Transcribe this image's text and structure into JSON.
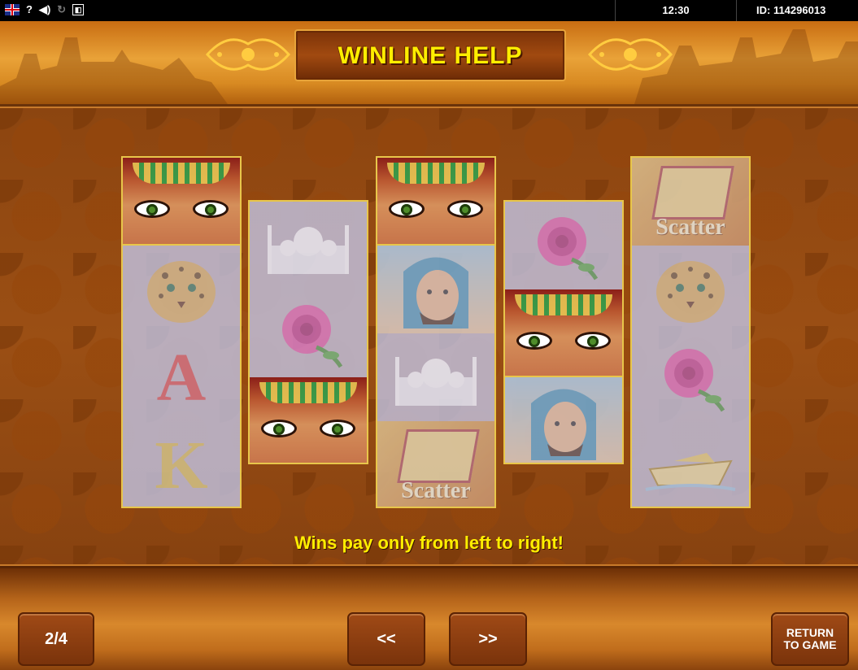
{
  "status_bar": {
    "help_icon": "?",
    "time": "12:30",
    "id": "ID: 114296013"
  },
  "header": {
    "title": "WINLINE HELP"
  },
  "reels": [
    {
      "symbols": [
        {
          "name": "eyes",
          "label": "",
          "highlight": true
        },
        {
          "name": "leopard",
          "label": "",
          "highlight": false
        },
        {
          "name": "letter-a",
          "label": "A",
          "highlight": false
        },
        {
          "name": "letter-k",
          "label": "K",
          "highlight": false
        }
      ]
    },
    {
      "symbols": [
        {
          "name": "mosque",
          "label": "",
          "highlight": false
        },
        {
          "name": "rose",
          "label": "",
          "highlight": false
        },
        {
          "name": "eyes",
          "label": "",
          "highlight": true
        }
      ]
    },
    {
      "symbols": [
        {
          "name": "eyes",
          "label": "",
          "highlight": true
        },
        {
          "name": "sheikh",
          "label": "",
          "highlight": false
        },
        {
          "name": "mosque",
          "label": "",
          "highlight": false
        },
        {
          "name": "scatter",
          "label": "Scatter",
          "highlight": false
        }
      ]
    },
    {
      "symbols": [
        {
          "name": "rose",
          "label": "",
          "highlight": false
        },
        {
          "name": "eyes",
          "label": "",
          "highlight": true
        },
        {
          "name": "sheikh",
          "label": "",
          "highlight": false
        }
      ]
    },
    {
      "symbols": [
        {
          "name": "scatter",
          "label": "Scatter",
          "highlight": false
        },
        {
          "name": "leopard",
          "label": "",
          "highlight": false
        },
        {
          "name": "rose",
          "label": "",
          "highlight": false
        },
        {
          "name": "yacht",
          "label": "",
          "highlight": false
        }
      ]
    }
  ],
  "message": "Wins pay only from left to right!",
  "footer": {
    "page_indicator": "2/4",
    "prev_label": "<<",
    "next_label": ">>",
    "return_label_line1": "RETURN",
    "return_label_line2": "TO GAME"
  },
  "colors": {
    "title_yellow": "#ffee00",
    "reel_border": "#e8c64a",
    "button_brown": "#8a3a10"
  }
}
